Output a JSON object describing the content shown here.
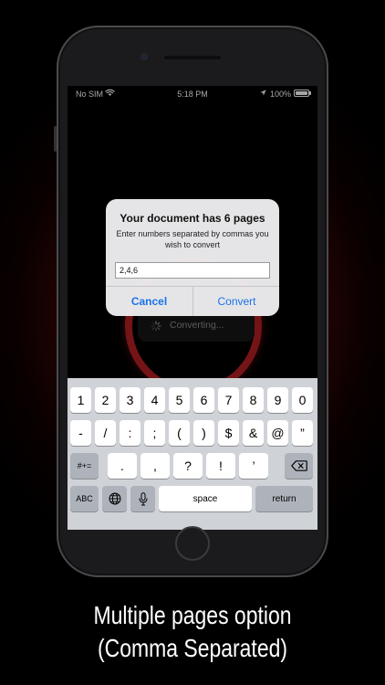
{
  "status_bar": {
    "carrier": "No SIM",
    "time": "5:18 PM",
    "battery": "100%"
  },
  "background": {
    "progress_label": "Converting..."
  },
  "alert": {
    "title": "Your document has 6 pages",
    "message": "Enter numbers separated by commas you wish to convert",
    "input_value": "2,4,6",
    "cancel_label": "Cancel",
    "convert_label": "Convert"
  },
  "keyboard": {
    "row1": [
      "1",
      "2",
      "3",
      "4",
      "5",
      "6",
      "7",
      "8",
      "9",
      "0"
    ],
    "row2": [
      "-",
      "/",
      ":",
      ";",
      "(",
      ")",
      "$",
      "&",
      "@",
      "”"
    ],
    "row3_shift": "#+=",
    "row3": [
      ".",
      ",",
      "?",
      "!",
      "’"
    ],
    "abc_label": "ABC",
    "space_label": "space",
    "return_label": "return"
  },
  "caption": {
    "line1": "Multiple pages option",
    "line2": "(Comma Separated)"
  },
  "colors": {
    "ring": "#b31f24",
    "accent_blue": "#1a73e8",
    "keyboard_bg": "#cfd2d7"
  }
}
